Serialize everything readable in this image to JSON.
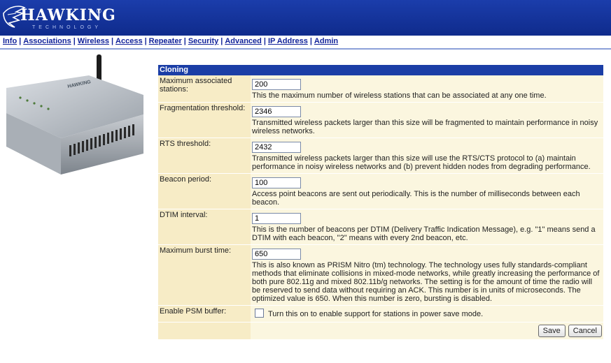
{
  "brand": {
    "name": "HAWKING",
    "registered": "®",
    "subtitle": "TECHNOLOGY"
  },
  "nav": {
    "items": [
      "Info",
      "Associations",
      "Wireless",
      "Access",
      "Repeater",
      "Security",
      "Advanced",
      "IP Address",
      "Admin"
    ]
  },
  "section": {
    "title": "Cloning"
  },
  "fields": [
    {
      "label": "Maximum associated stations:",
      "value": "200",
      "description": "This the maximum number of wireless stations that can be associated at any one time."
    },
    {
      "label": "Fragmentation threshold:",
      "value": "2346",
      "description": "Transmitted wireless packets larger than this size will be fragmented to maintain performance in noisy wireless networks."
    },
    {
      "label": "RTS threshold:",
      "value": "2432",
      "description": "Transmitted wireless packets larger than this size will use the RTS/CTS protocol to (a) maintain performance in noisy wireless networks and (b) prevent hidden nodes from degrading performance."
    },
    {
      "label": "Beacon period:",
      "value": "100",
      "description": "Access point beacons are sent out periodically. This is the number of milliseconds between each beacon."
    },
    {
      "label": "DTIM interval:",
      "value": "1",
      "description": "This is the number of beacons per DTIM (Delivery Traffic Indication Message), e.g. \"1\" means send a DTIM with each beacon, \"2\" means with every 2nd beacon, etc."
    },
    {
      "label": "Maximum burst time:",
      "value": "650",
      "description": "This is also known as PRISM Nitro (tm) technology. The technology uses fully standards-compliant methods that eliminate collisions in mixed-mode networks, while greatly increasing the performance of both pure 802.11g and mixed 802.11b/g networks. The setting is for the amount of time the radio will be reserved to send data without requiring an ACK. This number is in units of microseconds. The optimized value is 650. When this number is zero, bursting is disabled."
    }
  ],
  "psm": {
    "label": "Enable PSM buffer:",
    "checkbox_label": "Turn this on to enable support for stations in power save mode.",
    "checked": false
  },
  "buttons": {
    "save": "Save",
    "cancel": "Cancel"
  },
  "device": {
    "brand_text": "HAWKING"
  }
}
